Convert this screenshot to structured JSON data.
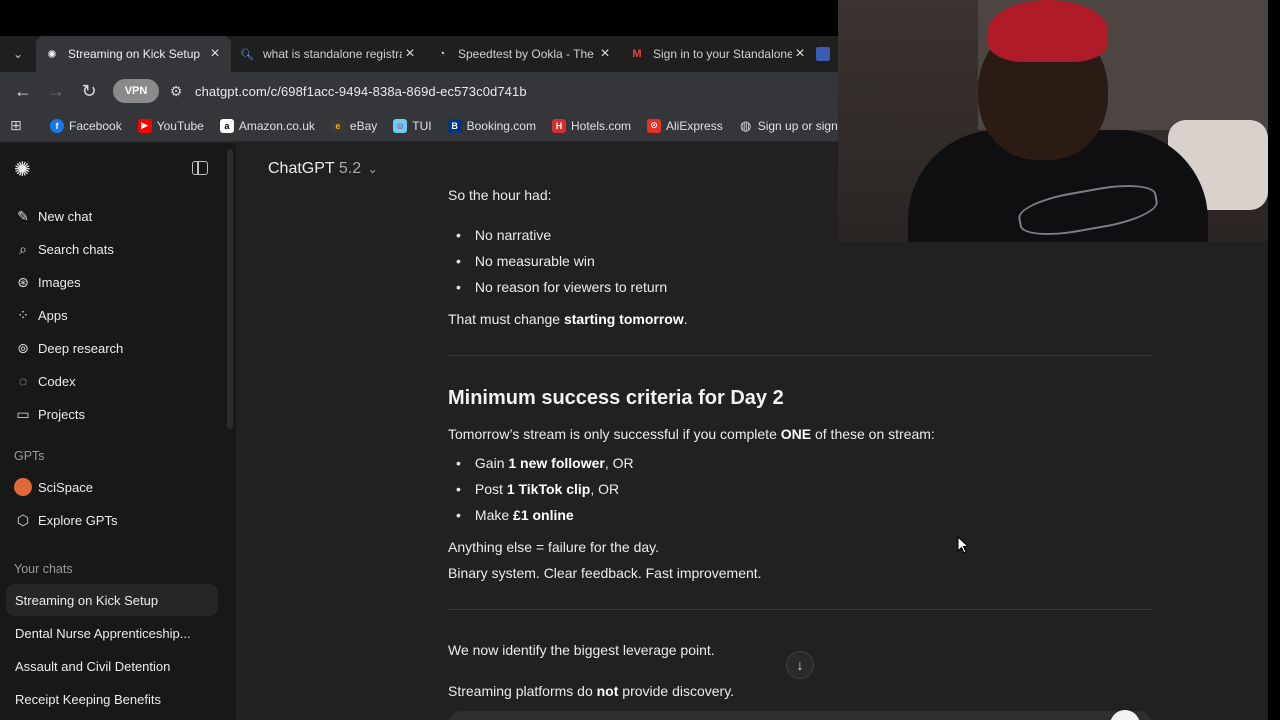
{
  "browser": {
    "tabs": [
      {
        "title": "Streaming on Kick Setup",
        "active": true,
        "favicon": "chatgpt-icon"
      },
      {
        "title": "what is standalone registra",
        "active": false,
        "favicon": "search-icon"
      },
      {
        "title": "Speedtest by Ookla - The G",
        "active": false,
        "favicon": "speedtest-icon"
      },
      {
        "title": "Sign in to your Standalone",
        "active": false,
        "favicon": "gmail-icon"
      }
    ],
    "vpn_label": "VPN",
    "url": "chatgpt.com/c/698f1acc-9494-838a-869d-ec573c0d741b",
    "bookmarks": [
      "Facebook",
      "YouTube",
      "Amazon.co.uk",
      "eBay",
      "TUI",
      "Booking.com",
      "Hotels.com",
      "AliExpress",
      "Sign up or sign in"
    ]
  },
  "sidebar": {
    "nav": [
      "New chat",
      "Search chats",
      "Images",
      "Apps",
      "Deep research",
      "Codex",
      "Projects"
    ],
    "gpts_label": "GPTs",
    "gpts": [
      "SciSpace",
      "Explore GPTs"
    ],
    "chats_label": "Your chats",
    "chats": [
      "Streaming on Kick Setup",
      "Dental Nurse Apprenticeship...",
      "Assault and Civil Detention",
      "Receipt Keeping Benefits"
    ]
  },
  "main": {
    "model_name": "ChatGPT",
    "model_version": "5.2",
    "intro": "So the hour had:",
    "list1": [
      "No narrative",
      "No measurable win",
      "No reason for viewers to return"
    ],
    "change_pre": "That must change ",
    "change_bold": "starting tomorrow",
    "change_post": ".",
    "heading": "Minimum success criteria for Day 2",
    "criteria_pre": "Tomorrow’s stream is only successful if you complete ",
    "criteria_bold": "ONE",
    "criteria_post": " of these on stream:",
    "list2": [
      {
        "pre": "Gain ",
        "bold": "1 new follower",
        "post": ", OR"
      },
      {
        "pre": "Post ",
        "bold": "1 TikTok clip",
        "post": ", OR"
      },
      {
        "pre": "Make ",
        "bold": "£1 online",
        "post": ""
      }
    ],
    "failure": "Anything else = failure for the day.",
    "binary": "Binary system. Clear feedback. Fast improvement.",
    "leverage": "We now identify the biggest leverage point.",
    "platforms_pre": "Streaming platforms do ",
    "platforms_bold": "not",
    "platforms_post": " provide discovery."
  }
}
